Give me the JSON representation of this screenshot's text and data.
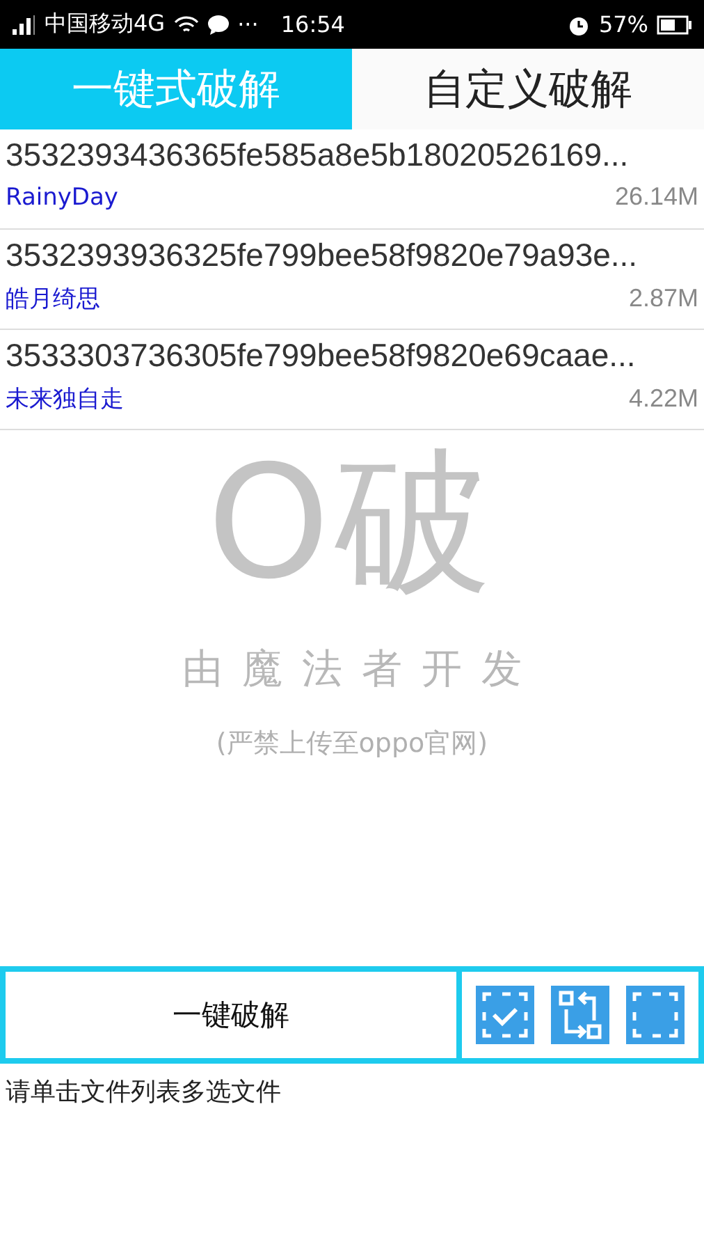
{
  "status_bar": {
    "carrier": "中国移动4G",
    "more": "···",
    "time": "16:54",
    "battery": "57%"
  },
  "tabs": [
    {
      "label": "一键式破解",
      "selected": true
    },
    {
      "label": "自定义破解",
      "selected": false
    }
  ],
  "files": [
    {
      "name": "3532393436365fe585a8e5b18020526169...",
      "author": "RainyDay",
      "size": "26.14M"
    },
    {
      "name": "3532393936325fe799bee58f9820e79a93e...",
      "author": "皓月绮思",
      "size": "2.87M"
    },
    {
      "name": "3533303736305fe799bee58f9820e69caae...",
      "author": "未来独自走",
      "size": "4.22M"
    }
  ],
  "logo": "O破",
  "developer": "由魔法者开发",
  "notice": "(严禁上传至oppo官网)",
  "action_button": "一键破解",
  "tools": [
    {
      "kind": "select-all"
    },
    {
      "kind": "invert"
    },
    {
      "kind": "clear"
    }
  ],
  "hint": "请单击文件列表多选文件"
}
